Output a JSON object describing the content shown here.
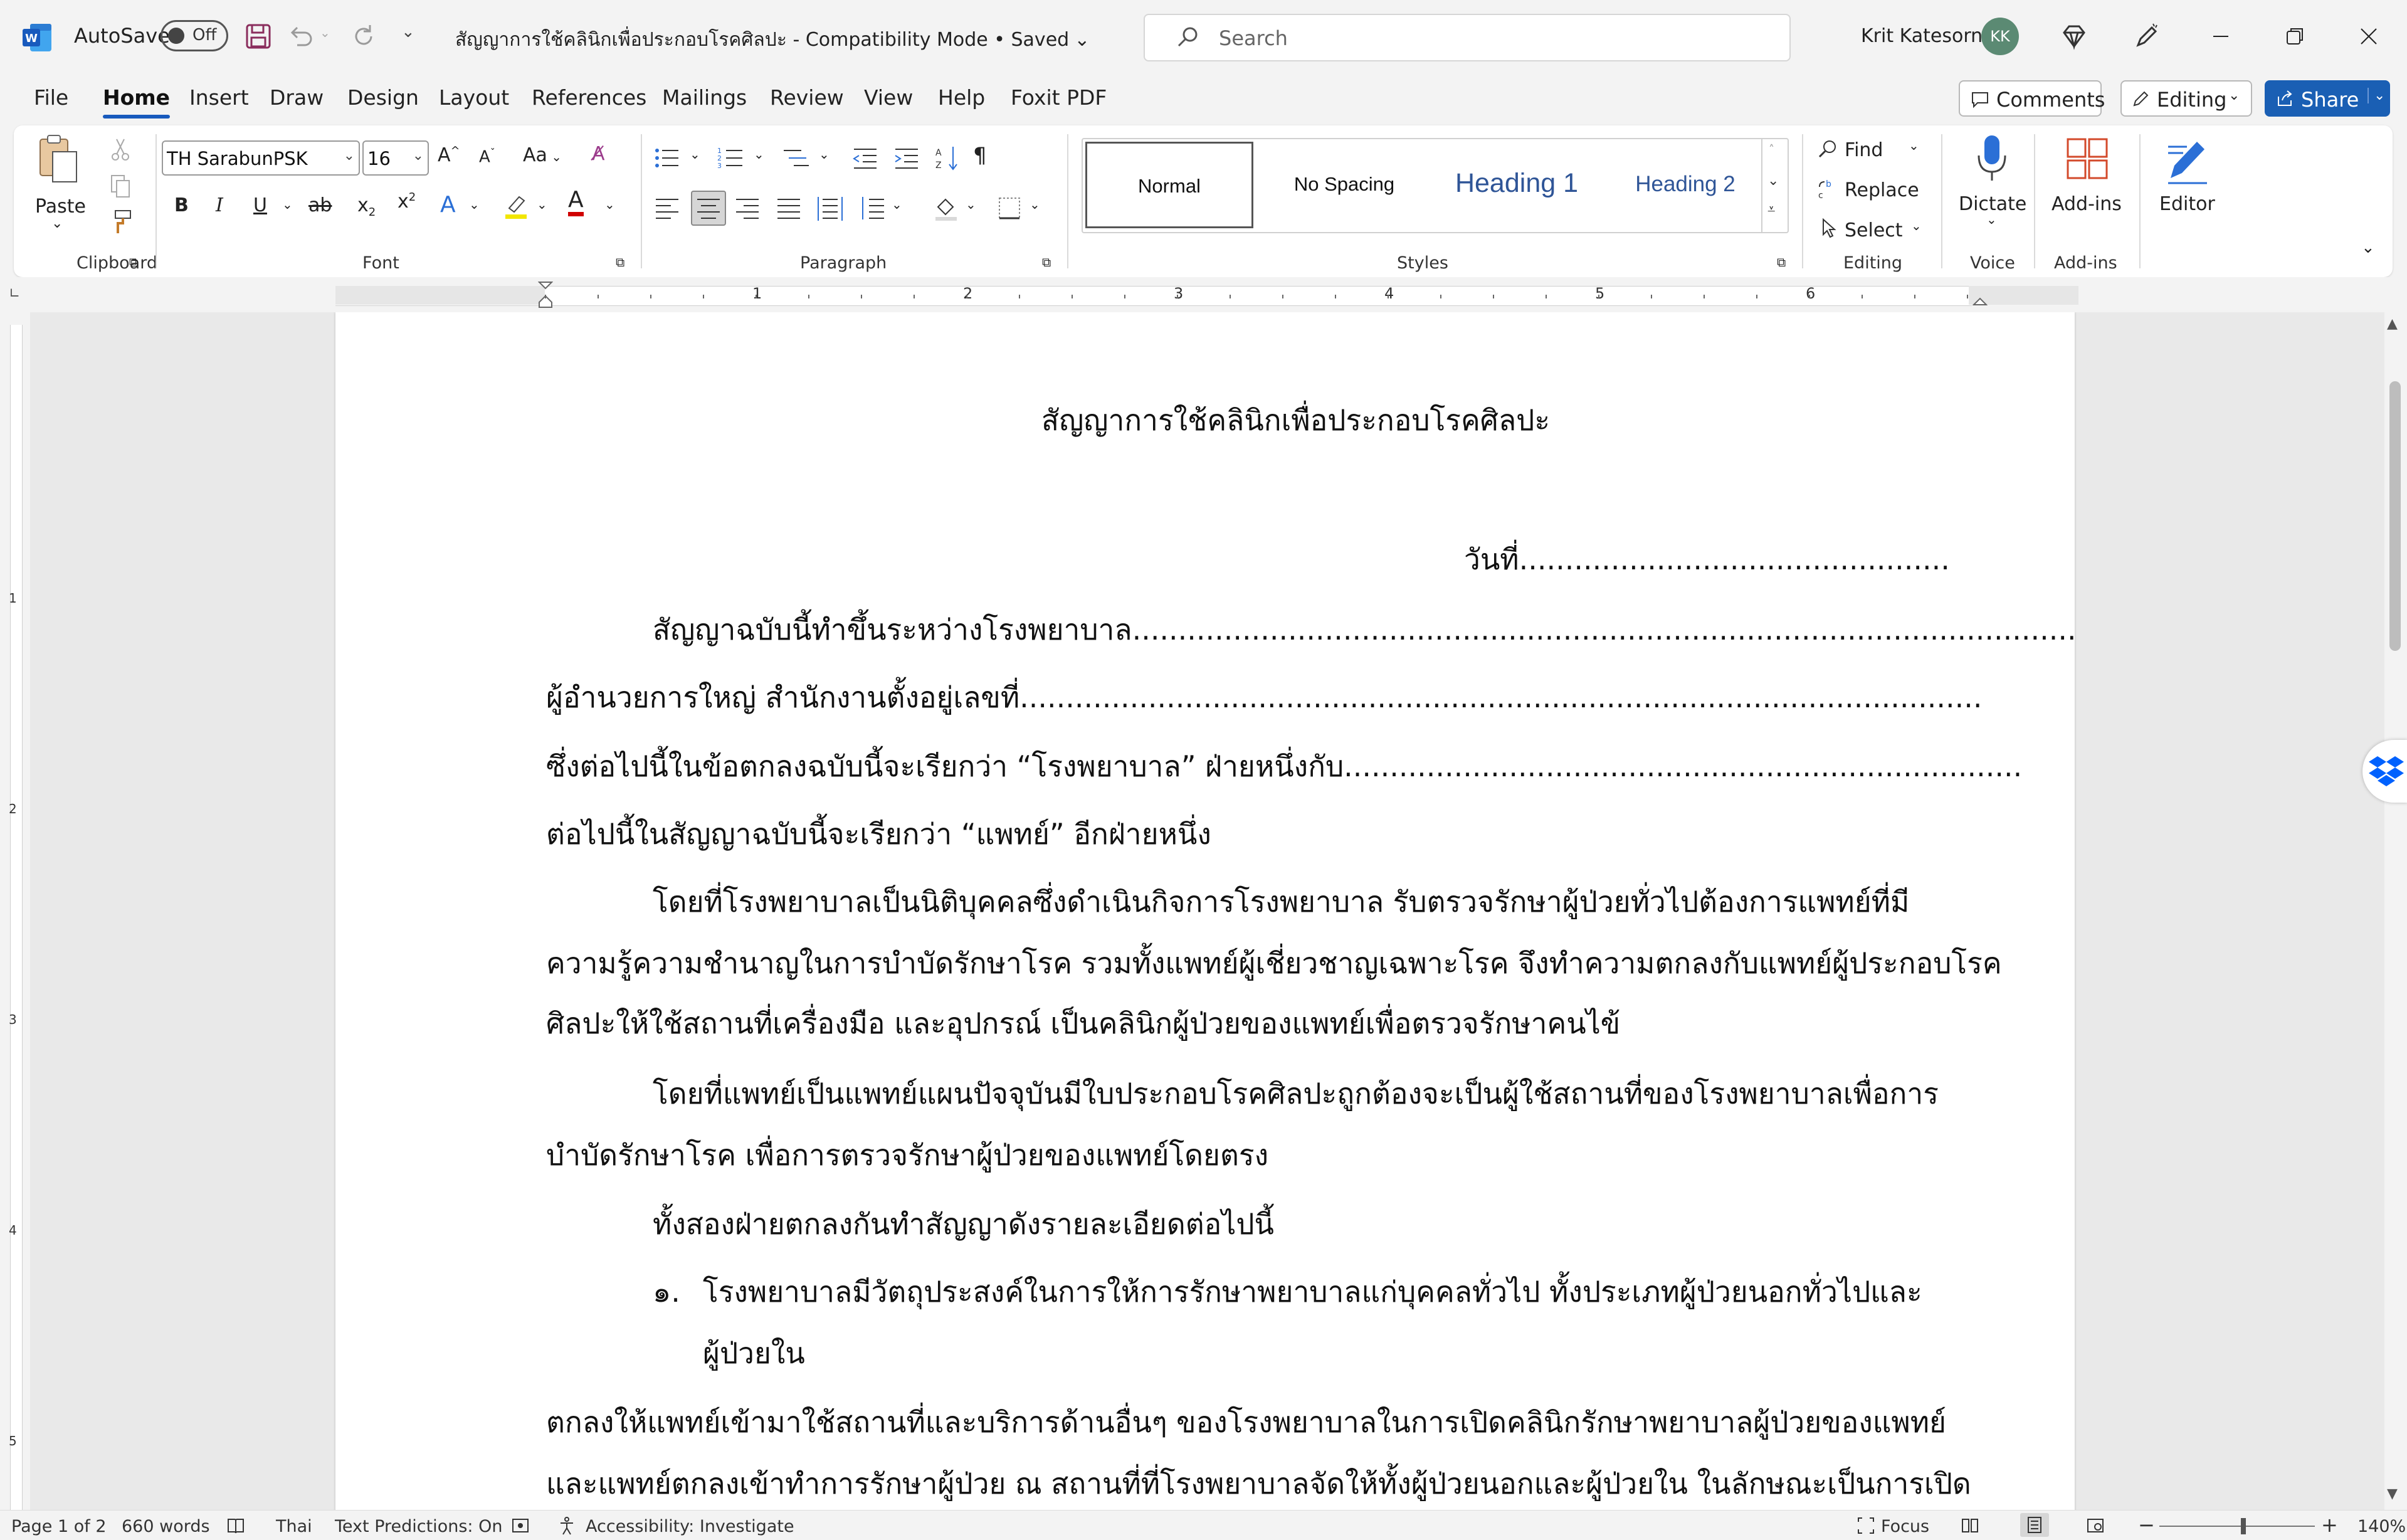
{
  "titlebar": {
    "autosave_label": "AutoSave",
    "autosave_state": "Off",
    "document_title": "สัญญาการใช้คลินิกเพื่อประกอบโรคศิลปะ  -  Compatibility Mode • Saved",
    "search_placeholder": "Search",
    "user_name": "Krit Katesorn",
    "user_initials": "KK"
  },
  "menu": {
    "tabs": [
      "File",
      "Home",
      "Insert",
      "Draw",
      "Design",
      "Layout",
      "References",
      "Mailings",
      "Review",
      "View",
      "Help",
      "Foxit PDF"
    ],
    "active_tab": "Home",
    "comments_label": "Comments",
    "editing_label": "Editing",
    "share_label": "Share"
  },
  "ribbon": {
    "clipboard": {
      "paste_label": "Paste",
      "group_label": "Clipboard"
    },
    "font": {
      "font_name": "TH SarabunPSK",
      "font_size": "16",
      "group_label": "Font",
      "change_case": "Aa"
    },
    "paragraph": {
      "group_label": "Paragraph"
    },
    "styles": {
      "group_label": "Styles",
      "items": [
        "Normal",
        "No Spacing",
        "Heading 1",
        "Heading 2"
      ]
    },
    "editing": {
      "find_label": "Find",
      "replace_label": "Replace",
      "select_label": "Select",
      "group_label": "Editing"
    },
    "voice": {
      "dictate_label": "Dictate",
      "group_label": "Voice"
    },
    "addins": {
      "addins_label": "Add-ins",
      "group_label": "Add-ins"
    },
    "editor": {
      "editor_label": "Editor"
    }
  },
  "ruler": {
    "numbers": [
      "1",
      "2",
      "3",
      "4",
      "5",
      "6"
    ],
    "v_numbers": [
      "1",
      "2",
      "3",
      "4",
      "5"
    ]
  },
  "document": {
    "title": "สัญญาการใช้คลินิกเพื่อประกอบโรคศิลปะ",
    "date_line": "วันที่...............................................",
    "lines": [
      "สัญญาฉบับนี้ทำขึ้นระหว่างโรงพยาบาล.......................................................................................................",
      "ผู้อำนวยการใหญ่ สำนักงานตั้งอยู่เลขที่.........................................................................................................",
      "ซึ่งต่อไปนี้ในข้อตกลงฉบับนี้จะเรียกว่า “โรงพยาบาล” ฝ่ายหนึ่งกับ..........................................................................",
      "ต่อไปนี้ในสัญญาฉบับนี้จะเรียกว่า “แพทย์” อีกฝ่ายหนึ่ง",
      "โดยที่โรงพยาบาลเป็นนิติบุคคลซึ่งดำเนินกิจการโรงพยาบาล รับตรวจรักษาผู้ป่วยทั่วไปต้องการแพทย์ที่มี",
      "ความรู้ความชำนาญในการบำบัดรักษาโรค รวมทั้งแพทย์ผู้เชี่ยวชาญเฉพาะโรค จึงทำความตกลงกับแพทย์ผู้ประกอบโรค",
      "ศิลปะให้ใช้สถานที่เครื่องมือ และอุปกรณ์ เป็นคลินิกผู้ป่วยของแพทย์เพื่อตรวจรักษาคนไข้",
      "โดยที่แพทย์เป็นแพทย์แผนปัจจุบันมีใบประกอบโรคศิลปะถูกต้องจะเป็นผู้ใช้สถานที่ของโรงพยาบาลเพื่อการ",
      "บำบัดรักษาโรค เพื่อการตรวจรักษาผู้ป่วยของแพทย์โดยตรง",
      "ทั้งสองฝ่ายตกลงกันทำสัญญาดังรายละเอียดต่อไปนี้",
      "โรงพยาบาลมีวัตถุประสงค์ในการให้การรักษาพยาบาลแก่บุคคลทั่วไป ทั้งประเภทผู้ป่วยนอกทั่วไปและ",
      "ผู้ป่วยใน",
      "ตกลงให้แพทย์เข้ามาใช้สถานที่และบริการด้านอื่นๆ ของโรงพยาบาลในการเปิดคลินิกรักษาพยาบาลผู้ป่วยของแพทย์",
      "และแพทย์ตกลงเข้าทำการรักษาผู้ป่วย ณ สถานที่ที่โรงพยาบาลจัดให้ทั้งผู้ป่วยนอกและผู้ป่วยใน ในลักษณะเป็นการเปิด"
    ],
    "list_marker": "๑."
  },
  "statusbar": {
    "page": "Page 1 of 2",
    "words": "660 words",
    "language": "Thai",
    "text_predictions": "Text Predictions: On",
    "accessibility": "Accessibility: Investigate",
    "focus": "Focus",
    "zoom": "140%"
  },
  "colors": {
    "accent": "#185abd",
    "share": "#1a5fb4",
    "heading": "#2f5597"
  }
}
